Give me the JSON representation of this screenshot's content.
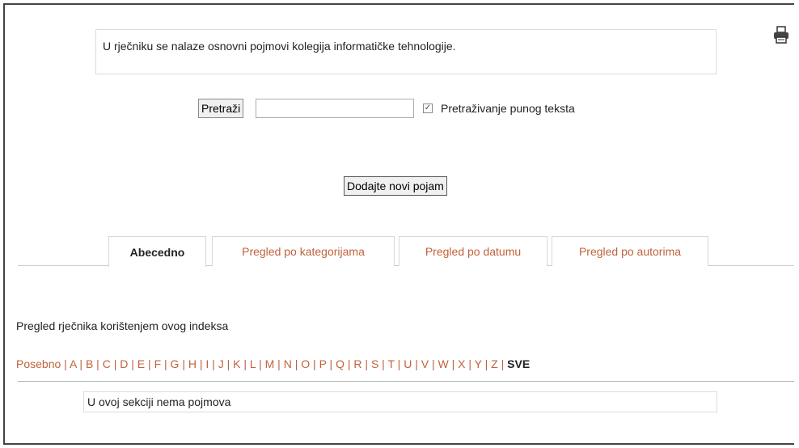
{
  "intro": {
    "text": "U rječniku se nalaze osnovni pojmovi kolegija informatičke tehnologije."
  },
  "icons": {
    "print": "printer-icon"
  },
  "search": {
    "button_label": "Pretraži",
    "input_value": "",
    "fulltext_checked": true,
    "fulltext_label": "Pretraživanje punog teksta"
  },
  "add_button_label": "Dodajte novi pojam",
  "tabs": [
    {
      "label": "Abecedno",
      "active": true
    },
    {
      "label": "Pregled po kategorijama",
      "active": false
    },
    {
      "label": "Pregled po datumu",
      "active": false
    },
    {
      "label": "Pregled po autorima",
      "active": false
    }
  ],
  "index_caption": "Pregled rječnika korištenjem ovog indeksa",
  "letters": [
    "Posebno",
    "A",
    "B",
    "C",
    "D",
    "E",
    "F",
    "G",
    "H",
    "I",
    "J",
    "K",
    "L",
    "M",
    "N",
    "O",
    "P",
    "Q",
    "R",
    "S",
    "T",
    "U",
    "V",
    "W",
    "X",
    "Y",
    "Z"
  ],
  "letters_current": "SVE",
  "empty_message": "U ovoj sekciji nema pojmova",
  "colors": {
    "link": "#c0623c",
    "text": "#222222",
    "border": "#dcdcdc"
  }
}
